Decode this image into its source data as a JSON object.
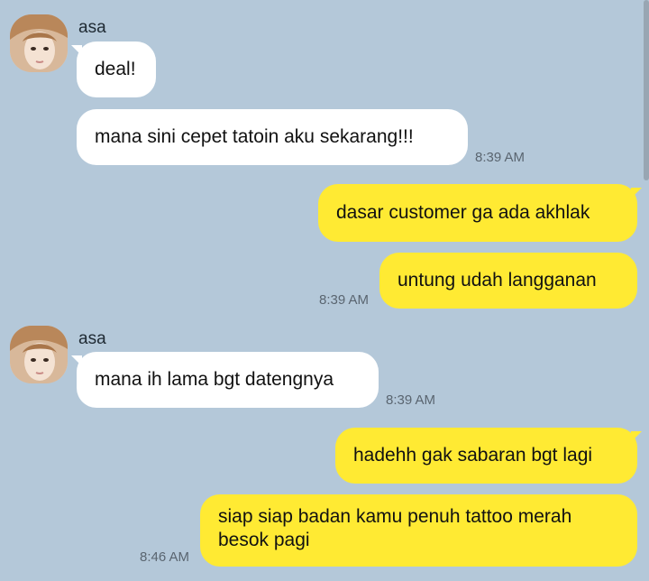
{
  "theme": {
    "background": "#b4c8d9",
    "incoming_bubble": "#ffffff",
    "outgoing_bubble": "#ffea33",
    "timestamp_color": "#5a6570"
  },
  "group1": {
    "sender": "asa",
    "avatar_icon": "profile-photo",
    "messages": [
      "deal!",
      "mana sini cepet tatoin aku sekarang!!!"
    ],
    "time": "8:39 AM"
  },
  "group2": {
    "messages": [
      "dasar customer ga ada akhlak",
      "untung udah langganan"
    ],
    "time": "8:39 AM"
  },
  "group3": {
    "sender": "asa",
    "avatar_icon": "profile-photo",
    "messages": [
      "mana ih lama bgt datengnya"
    ],
    "time": "8:39 AM"
  },
  "group4": {
    "messages": [
      "hadehh gak sabaran bgt lagi",
      "siap siap badan kamu penuh tattoo merah besok pagi"
    ],
    "time": "8:46 AM"
  }
}
